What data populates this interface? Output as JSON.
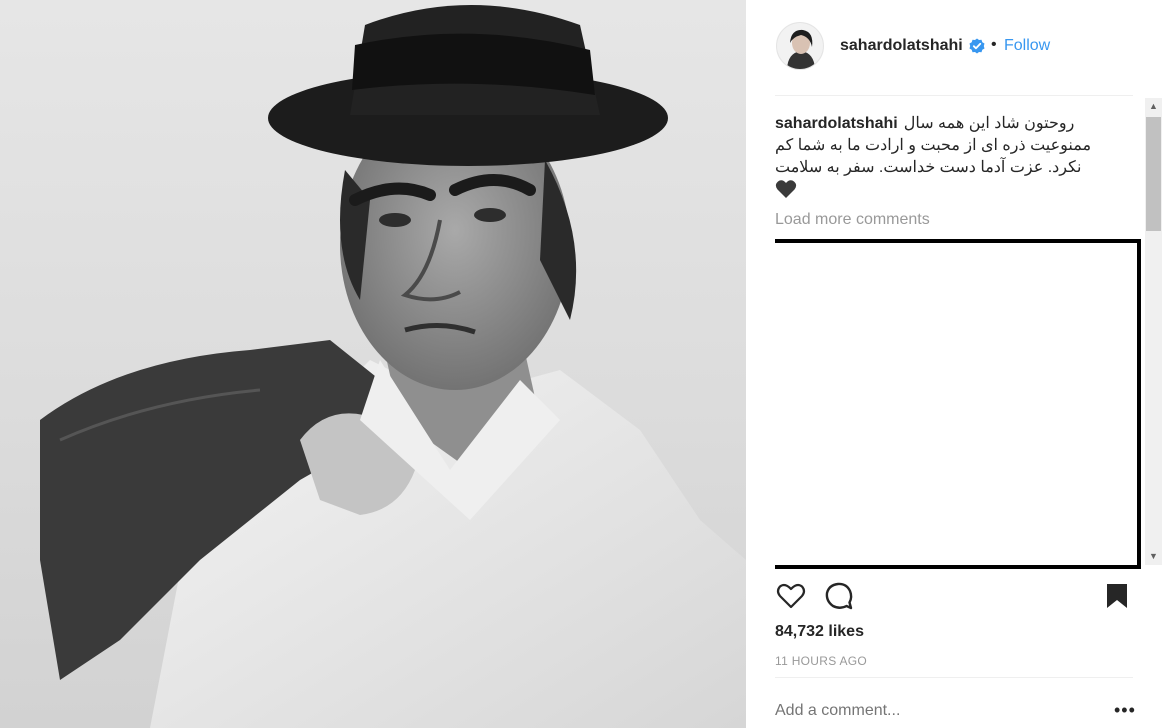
{
  "post": {
    "username": "sahardolatshahi",
    "follow_label": "Follow",
    "separator": "•"
  },
  "caption": {
    "username": "sahardolatshahi",
    "text": "روحتون شاد این همه سال ممنوعیت ذره ای از محبت و ارادت ما به شما کم نکرد. عزت آدما دست خداست. سفر به سلامت"
  },
  "comments": {
    "load_more": "Load more comments"
  },
  "stats": {
    "likes": "84,732 likes",
    "timestamp": "11 HOURS AGO"
  },
  "composer": {
    "placeholder": "Add a comment...",
    "more": "•••"
  },
  "icons": {
    "like": "heart-icon",
    "comment": "comment-icon",
    "save": "bookmark-icon",
    "verified": "verified-badge-icon"
  },
  "colors": {
    "link": "#3897f0",
    "verified": "#3897f0",
    "muted": "#999999",
    "text": "#262626"
  }
}
